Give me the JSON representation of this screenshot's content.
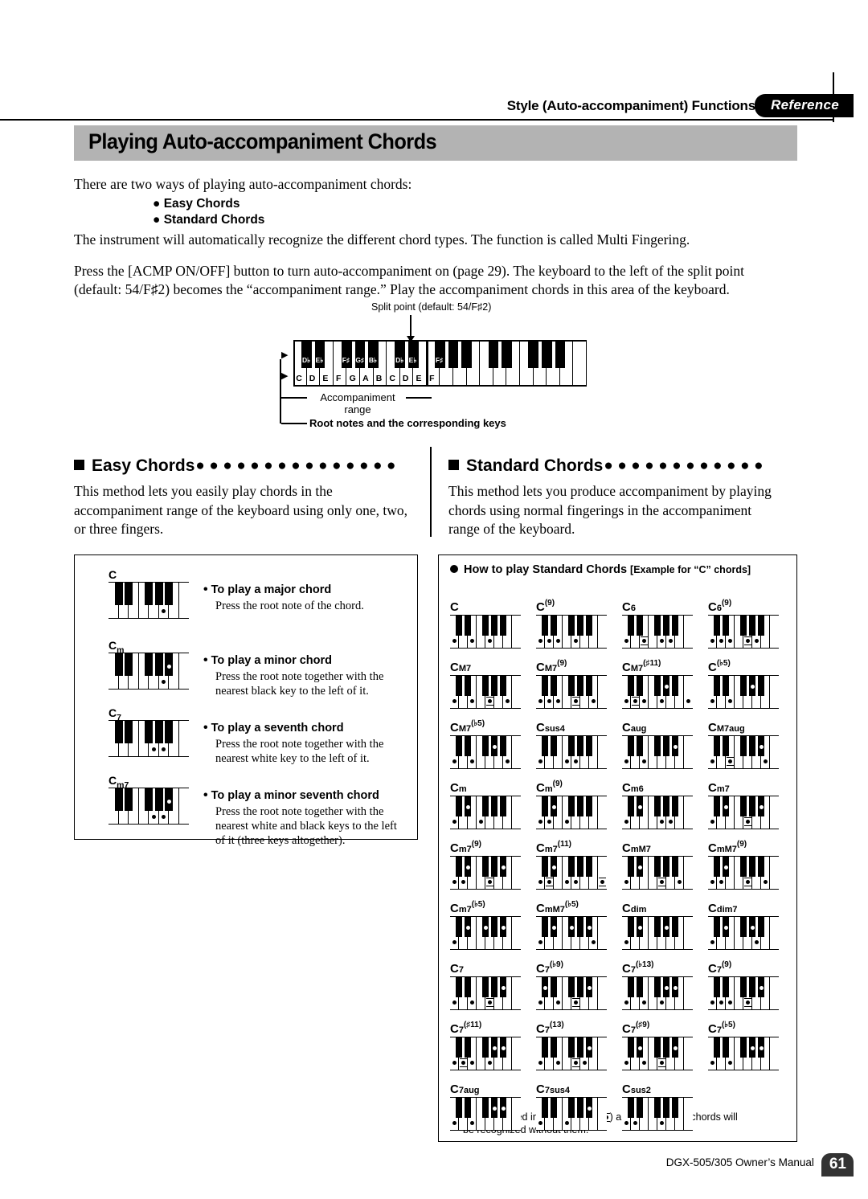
{
  "header": {
    "title": "Style (Auto-accompaniment) Functions",
    "tab_label": "Reference"
  },
  "page_title": "Playing Auto-accompaniment Chords",
  "intro": {
    "line1": "There are two ways of playing auto-accompaniment chords:",
    "bullet1": "Easy Chords",
    "bullet2": "Standard Chords",
    "line2": "The instrument will automatically recognize the different chord types. The function is called Multi Fingering.",
    "line3": "Press the [ACMP ON/OFF] button to turn auto-accompaniment on (page 29). The keyboard to the left of the split point",
    "line4": "(default: 54/F♯2) becomes the “accompaniment range.” Play the accompaniment chords in this area of the keyboard."
  },
  "keyboard_diagram": {
    "split_point_label": "Split point (default: 54/F♯2)",
    "accompaniment_label_line1": "Accompaniment",
    "accompaniment_label_line2": "range",
    "root_notes_label": "Root notes and the corresponding keys",
    "white_key_labels": [
      "C",
      "D",
      "E",
      "F",
      "G",
      "A",
      "B",
      "C",
      "D",
      "E",
      "F"
    ],
    "black_key_labels": [
      "D♭",
      "E♭",
      "F♯",
      "G♯",
      "B♭",
      "D♭",
      "E♭",
      "F♯"
    ]
  },
  "easy_chords": {
    "heading": "Easy Chords",
    "body": "This method lets you easily play chords in the accompaniment range of the keyboard using only one, two, or three fingers.",
    "rows": [
      {
        "chord_root": "C",
        "chord_sub": "",
        "title": "To play a major chord",
        "desc": "Press the root note of the chord.",
        "white_dots": [
          6
        ],
        "black_dots": []
      },
      {
        "chord_root": "C",
        "chord_sub": "m",
        "title": "To play a minor chord",
        "desc": "Press the root note together with the nearest black key to the left of it.",
        "white_dots": [
          6
        ],
        "black_dots": [
          5
        ]
      },
      {
        "chord_root": "C",
        "chord_sub": "7",
        "title": "To play a seventh chord",
        "desc": "Press the root note together with the nearest white key to the left of it.",
        "white_dots": [
          5,
          6
        ],
        "black_dots": []
      },
      {
        "chord_root": "C",
        "chord_sub": "m7",
        "title": "To play a minor seventh chord",
        "desc": "Press the root note together with the nearest white and black keys to the left of it (three keys altogether).",
        "white_dots": [
          5,
          6
        ],
        "black_dots": [
          5
        ]
      }
    ]
  },
  "standard_chords": {
    "heading": "Standard Chords",
    "body": "This method lets you produce accompaniment by playing chords using normal fingerings in the accompaniment range of the keyboard.",
    "box_heading_main": "How to play Standard Chords",
    "box_heading_sub": "[Example for “C” chords]",
    "footnote_line1": "*  Notes enclosed in parentheses (",
    "footnote_line1b": ") are optional; the chords will",
    "footnote_line2": "be recognized without them.",
    "chords": [
      {
        "root": "C",
        "sub": "",
        "sup": "",
        "white": [
          1,
          3,
          5
        ],
        "white_opt": [],
        "black": []
      },
      {
        "root": "C",
        "sub": "",
        "sup": "(9)",
        "white": [
          1,
          2,
          3,
          5
        ],
        "white_opt": [],
        "black": []
      },
      {
        "root": "C",
        "sub": "6",
        "sup": "",
        "white": [
          1,
          3,
          5,
          6
        ],
        "white_opt": [
          3
        ],
        "black": []
      },
      {
        "root": "C",
        "sub": "6",
        "sup": "(9)",
        "white": [
          1,
          2,
          3,
          5,
          6
        ],
        "white_opt": [
          5
        ],
        "black": []
      },
      {
        "root": "C",
        "sub": "M7",
        "sup": "",
        "white": [
          1,
          3,
          5,
          7
        ],
        "white_opt": [
          5
        ],
        "black": []
      },
      {
        "root": "C",
        "sub": "M7",
        "sup": "(9)",
        "white": [
          1,
          2,
          3,
          5,
          7
        ],
        "white_opt": [
          5
        ],
        "black": []
      },
      {
        "root": "C",
        "sub": "M7",
        "sup": "(♯11)",
        "white": [
          1,
          2,
          3,
          5,
          8
        ],
        "white_opt": [
          2
        ],
        "black": [
          4
        ]
      },
      {
        "root": "C",
        "sub": "",
        "sup": "(♭5)",
        "white": [
          1,
          3
        ],
        "white_opt": [],
        "black": [
          4
        ]
      },
      {
        "root": "C",
        "sub": "M7",
        "sup": "(♭5)",
        "white": [
          1,
          3,
          7
        ],
        "white_opt": [],
        "black": [
          4
        ]
      },
      {
        "root": "C",
        "sub": "sus4",
        "sup": "",
        "white": [
          1,
          4,
          5
        ],
        "white_opt": [],
        "black": []
      },
      {
        "root": "C",
        "sub": "aug",
        "sup": "",
        "white": [
          1,
          3
        ],
        "white_opt": [],
        "black": [
          5
        ]
      },
      {
        "root": "C",
        "sub": "M7aug",
        "sup": "",
        "white": [
          1,
          3,
          7
        ],
        "white_opt": [
          3
        ],
        "black": [
          5
        ]
      },
      {
        "root": "C",
        "sub": "m",
        "sup": "",
        "white": [
          1,
          4
        ],
        "white_opt": [],
        "black": [
          2
        ]
      },
      {
        "root": "C",
        "sub": "m",
        "sup": "(9)",
        "white": [
          1,
          2,
          4
        ],
        "white_opt": [],
        "black": [
          2
        ]
      },
      {
        "root": "C",
        "sub": "m6",
        "sup": "",
        "white": [
          1,
          5,
          6
        ],
        "white_opt": [],
        "black": [
          2
        ]
      },
      {
        "root": "C",
        "sub": "m7",
        "sup": "",
        "white": [
          1,
          5
        ],
        "white_opt": [
          5
        ],
        "black": [
          2,
          5
        ]
      },
      {
        "root": "C",
        "sub": "m7",
        "sup": "(9)",
        "white": [
          1,
          2,
          5
        ],
        "white_opt": [
          5
        ],
        "black": [
          2,
          5
        ]
      },
      {
        "root": "C",
        "sub": "m7",
        "sup": "(11)",
        "white": [
          1,
          2,
          4,
          5,
          8
        ],
        "white_opt": [
          2,
          8
        ],
        "black": [
          2
        ]
      },
      {
        "root": "C",
        "sub": "mM7",
        "sup": "",
        "white": [
          1,
          5,
          7
        ],
        "white_opt": [
          5
        ],
        "black": [
          2
        ]
      },
      {
        "root": "C",
        "sub": "mM7",
        "sup": "(9)",
        "white": [
          1,
          2,
          5,
          7
        ],
        "white_opt": [
          5
        ],
        "black": [
          2
        ]
      },
      {
        "root": "C",
        "sub": "m7",
        "sup": "(♭5)",
        "white": [
          1
        ],
        "white_opt": [],
        "black": [
          2,
          3,
          5
        ]
      },
      {
        "root": "C",
        "sub": "mM7",
        "sup": "(♭5)",
        "white": [
          1,
          7
        ],
        "white_opt": [],
        "black": [
          2,
          3,
          5
        ]
      },
      {
        "root": "C",
        "sub": "dim",
        "sup": "",
        "white": [
          1
        ],
        "white_opt": [],
        "black": [
          2,
          4
        ]
      },
      {
        "root": "C",
        "sub": "dim7",
        "sup": "",
        "white": [
          1,
          6
        ],
        "white_opt": [],
        "black": [
          2,
          4
        ]
      },
      {
        "root": "C",
        "sub": "7",
        "sup": "",
        "white": [
          1,
          3,
          5
        ],
        "white_opt": [
          5
        ],
        "black": [
          5
        ]
      },
      {
        "root": "C",
        "sub": "7",
        "sup": "(♭9)",
        "white": [
          1,
          3,
          5
        ],
        "white_opt": [
          5
        ],
        "black": [
          1,
          5
        ]
      },
      {
        "root": "C",
        "sub": "7",
        "sup": "(♭13)",
        "white": [
          1,
          3,
          5
        ],
        "white_opt": [],
        "black": [
          4,
          5
        ]
      },
      {
        "root": "C",
        "sub": "7",
        "sup": "(9)",
        "white": [
          1,
          2,
          3,
          5
        ],
        "white_opt": [
          5
        ],
        "black": [
          5
        ]
      },
      {
        "root": "C",
        "sub": "7",
        "sup": "(♯11)",
        "white": [
          1,
          2,
          3,
          5
        ],
        "white_opt": [
          2
        ],
        "black": [
          4,
          5
        ]
      },
      {
        "root": "C",
        "sub": "7",
        "sup": "(13)",
        "white": [
          1,
          3,
          5,
          6
        ],
        "white_opt": [
          5
        ],
        "black": [
          5
        ]
      },
      {
        "root": "C",
        "sub": "7",
        "sup": "(♯9)",
        "white": [
          1,
          3,
          5
        ],
        "white_opt": [
          5
        ],
        "black": [
          2,
          5
        ]
      },
      {
        "root": "C",
        "sub": "7",
        "sup": "(♭5)",
        "white": [
          1,
          3
        ],
        "white_opt": [],
        "black": [
          4,
          5
        ]
      },
      {
        "root": "C",
        "sub": "7aug",
        "sup": "",
        "white": [
          1,
          3
        ],
        "white_opt": [],
        "black": [
          4,
          5
        ]
      },
      {
        "root": "C",
        "sub": "7sus4",
        "sup": "",
        "white": [
          1,
          4
        ],
        "white_opt": [],
        "black": [
          5
        ]
      },
      {
        "root": "C",
        "sub": "sus2",
        "sup": "",
        "white": [
          1,
          2,
          5
        ],
        "white_opt": [],
        "black": []
      }
    ]
  },
  "footer": {
    "manual": "DGX-505/305  Owner’s Manual",
    "page_number": "61"
  }
}
